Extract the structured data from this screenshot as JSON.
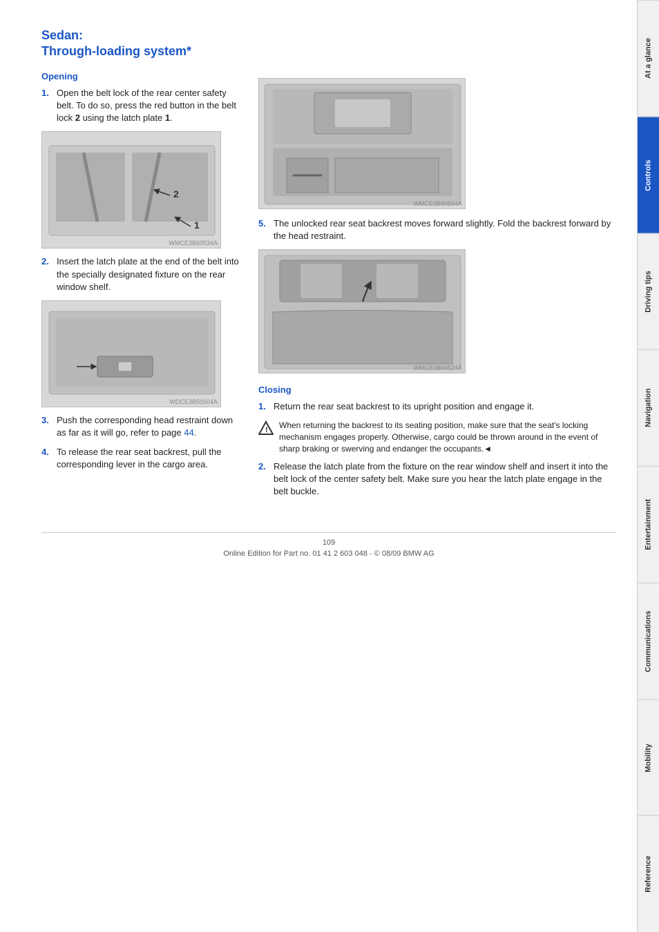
{
  "page": {
    "title_line1": "Sedan:",
    "title_line2": "Through-loading system*",
    "opening_label": "Opening",
    "closing_label": "Closing",
    "opening_steps": [
      {
        "number": "1.",
        "text": "Open the belt lock of the rear center safety belt. To do so, press the red button in the belt lock ",
        "bold": "2",
        "text2": " using the latch plate ",
        "bold2": "1",
        "text3": "."
      },
      {
        "number": "2.",
        "text": "Insert the latch plate at the end of the belt into the specially designated fixture on the rear window shelf."
      },
      {
        "number": "3.",
        "text": "Push the corresponding head restraint down as far as it will go, refer to page ",
        "link": "44",
        "text2": "."
      },
      {
        "number": "4.",
        "text": "To release the rear seat backrest, pull the corresponding lever in the cargo area."
      }
    ],
    "right_steps_before_closing": [
      {
        "number": "5.",
        "text": "The unlocked rear seat backrest moves forward slightly. Fold the backrest forward by the head restraint."
      }
    ],
    "closing_steps": [
      {
        "number": "1.",
        "text": "Return the rear seat backrest to its upright position and engage it."
      },
      {
        "number": "2.",
        "text": "Release the latch plate from the fixture on the rear window shelf and insert it into the belt lock of the center safety belt. Make sure you hear the latch plate engage in the belt buckle."
      }
    ],
    "warning_text": "When returning the backrest to its seating position, make sure that the seat's locking mechanism engages properly. Otherwise, cargo could be thrown around in the event of sharp braking or swerving and endanger the occupants.",
    "warning_symbol": "◄",
    "page_number": "109",
    "footer_text": "Online Edition for Part no. 01 41 2 603 048 - © 08/09 BMW AG",
    "sidebar_tabs": [
      {
        "label": "At a glance",
        "active": false
      },
      {
        "label": "Controls",
        "active": true
      },
      {
        "label": "Driving tips",
        "active": false
      },
      {
        "label": "Navigation",
        "active": false
      },
      {
        "label": "Entertainment",
        "active": false
      },
      {
        "label": "Communications",
        "active": false
      },
      {
        "label": "Mobility",
        "active": false
      },
      {
        "label": "Reference",
        "active": false
      }
    ],
    "image_captions": [
      "WMCE3B60534A",
      "WDCE3B50504A",
      "WMCE3B60504A",
      "WMCE3B60524A"
    ]
  }
}
